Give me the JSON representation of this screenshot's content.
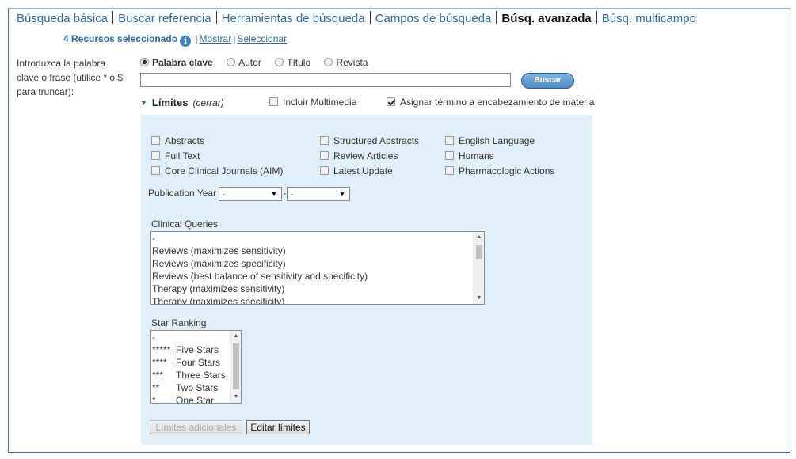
{
  "nav": {
    "items": [
      {
        "label": "Búsqueda básica"
      },
      {
        "label": "Buscar referencia"
      },
      {
        "label": "Herramientas de búsqueda"
      },
      {
        "label": "Campos de búsqueda"
      },
      {
        "label": "Búsq. avanzada"
      },
      {
        "label": "Búsq. multicampo"
      }
    ],
    "active_index": 4
  },
  "resources": {
    "count_label": "4 Recursos seleccionado",
    "info_icon": "i",
    "show_link": "Mostrar",
    "select_link": "Seleccionar"
  },
  "prompt": "Introduzca la palabra clave o frase (utilice * o $ para truncar):",
  "search_type": {
    "options": [
      {
        "label": "Palabra clave",
        "checked": true
      },
      {
        "label": "Autor",
        "checked": false
      },
      {
        "label": "Título",
        "checked": false
      },
      {
        "label": "Revista",
        "checked": false
      }
    ]
  },
  "search": {
    "value": "",
    "button_label": "Buscar"
  },
  "limits": {
    "title": "Límites",
    "close_label": "(cerrar)",
    "include_multimedia": {
      "label": "Incluir Multimedia",
      "checked": false
    },
    "assign_term": {
      "label": "Asignar término a encabezamiento de materia",
      "checked": true
    },
    "checkboxes": [
      {
        "label": "Abstracts",
        "checked": false
      },
      {
        "label": "Full Text",
        "checked": false
      },
      {
        "label": "Core Clinical Journals (AIM)",
        "checked": false
      },
      {
        "label": "Structured Abstracts",
        "checked": false
      },
      {
        "label": "Review Articles",
        "checked": false
      },
      {
        "label": "Latest Update",
        "checked": false
      },
      {
        "label": "English Language",
        "checked": false
      },
      {
        "label": "Humans",
        "checked": false
      },
      {
        "label": "Pharmacologic Actions",
        "checked": false
      }
    ],
    "publication_year": {
      "label": "Publication Year",
      "from": "-",
      "separator": "-",
      "to": "-"
    },
    "clinical_queries": {
      "label": "Clinical Queries",
      "options": [
        "-",
        "Reviews (maximizes sensitivity)",
        "Reviews (maximizes specificity)",
        "Reviews (best balance of sensitivity and specificity)",
        "Therapy (maximizes sensitivity)",
        "Therapy (maximizes specificity)"
      ]
    },
    "star_ranking": {
      "label": "Star Ranking",
      "options": [
        {
          "stars": "",
          "label": "-"
        },
        {
          "stars": "*****",
          "label": "Five Stars"
        },
        {
          "stars": "****",
          "label": "Four Stars"
        },
        {
          "stars": "***",
          "label": "Three Stars"
        },
        {
          "stars": "**",
          "label": "Two Stars"
        },
        {
          "stars": "*",
          "label": "One Star"
        }
      ]
    },
    "more_limits_label": "Límites adicionales",
    "edit_limits_label": "Editar límites"
  },
  "colors": {
    "link": "#2d6ca2",
    "panel_bg": "#e1effa",
    "button": "#4f8cc6"
  }
}
